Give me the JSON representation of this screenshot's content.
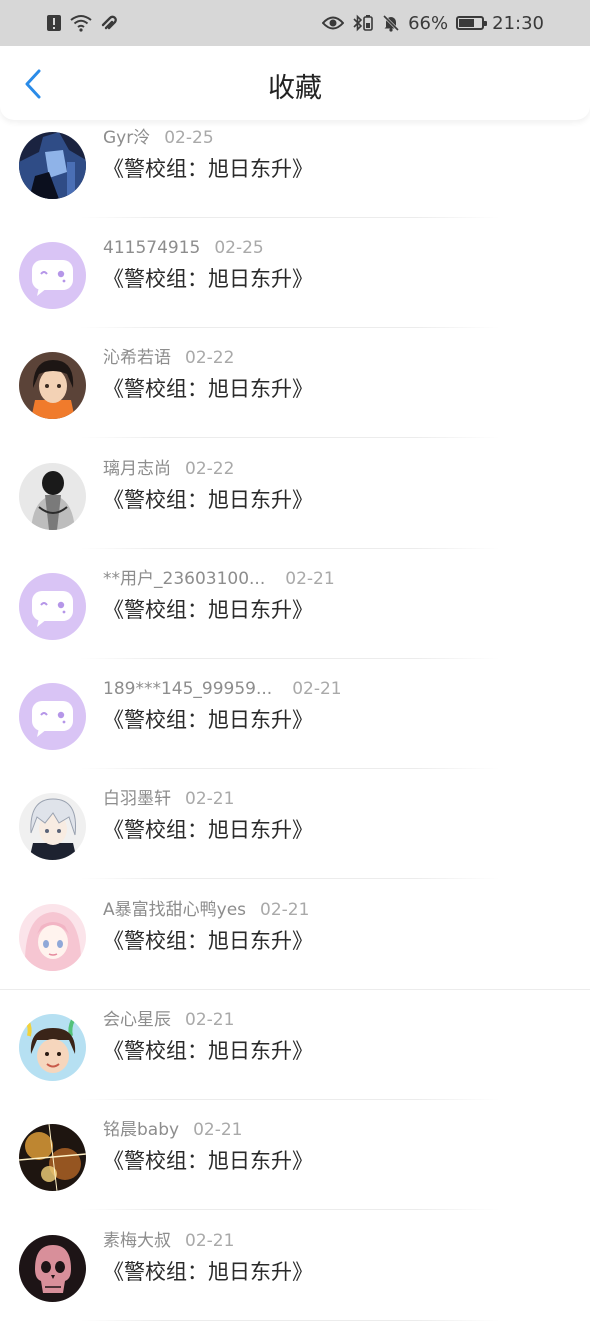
{
  "status_bar": {
    "battery_percent": "66%",
    "time": "21:30",
    "battery_level": 0.66
  },
  "header": {
    "title": "收藏"
  },
  "items": [
    {
      "user": "Gyr泠",
      "date": "02-25",
      "title": "《警校组：旭日东升》",
      "avatar": "photo-dark-anime"
    },
    {
      "user": "411574915",
      "date": "02-25",
      "title": "《警校组：旭日东升》",
      "avatar": "default-chat-bubble"
    },
    {
      "user": "沁希若语",
      "date": "02-22",
      "title": "《警校组：旭日东升》",
      "avatar": "anime-character"
    },
    {
      "user": "璃月志尚",
      "date": "02-22",
      "title": "《警校组：旭日东升》",
      "avatar": "monochrome-figure"
    },
    {
      "user": "**用户_23603100...",
      "date": "02-21",
      "title": "《警校组：旭日东升》",
      "avatar": "default-chat-bubble"
    },
    {
      "user": "189***145_99959...",
      "date": "02-21",
      "title": "《警校组：旭日东升》",
      "avatar": "default-chat-bubble"
    },
    {
      "user": "白羽墨轩",
      "date": "02-21",
      "title": "《警校组：旭日东升》",
      "avatar": "anime-white-hair"
    },
    {
      "user": "A暴富找甜心鸭yes",
      "date": "02-21",
      "title": "《警校组：旭日东升》",
      "avatar": "anime-pink-hair"
    },
    {
      "user": "会心星辰",
      "date": "02-21",
      "title": "《警校组：旭日东升》",
      "avatar": "child-photo"
    },
    {
      "user": "铭晨baby",
      "date": "02-21",
      "title": "《警校组：旭日东升》",
      "avatar": "sparkle-photo"
    },
    {
      "user": "素梅大叔",
      "date": "02-21",
      "title": "《警校组：旭日东升》",
      "avatar": "pink-skull"
    }
  ],
  "colors": {
    "accent": "#2a8be8",
    "default_avatar_bg": "#d9c4f5",
    "username": "#8d8d8d",
    "date": "#a9a9a9",
    "title_text": "#2a2a2a"
  }
}
